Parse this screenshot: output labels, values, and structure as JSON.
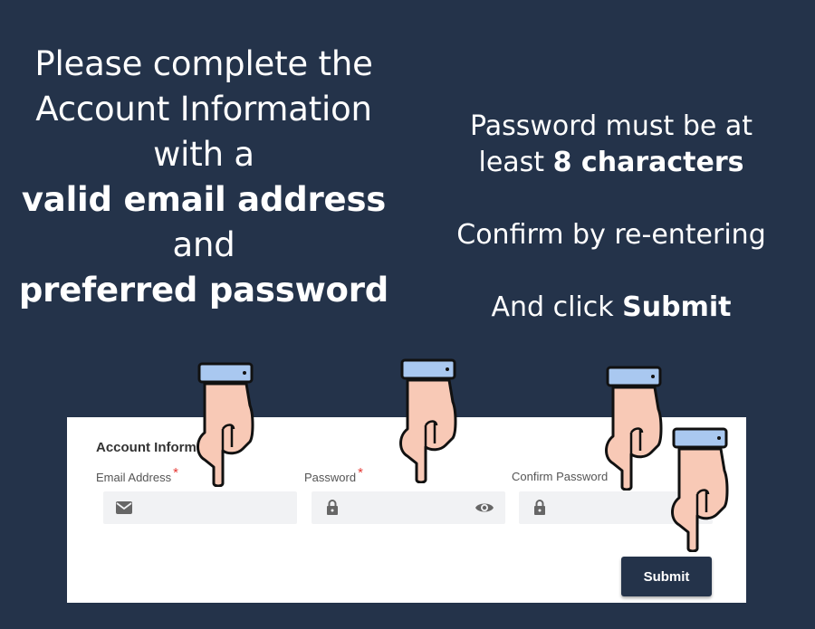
{
  "instructions_left": {
    "line1": "Please complete the",
    "line2": "Account Information",
    "line3": "with a",
    "line4": "valid email address",
    "line5": "and",
    "line6": "preferred password"
  },
  "instructions_right": {
    "line1": "Password must be at",
    "line2_prefix": "least ",
    "line2_bold": "8 characters",
    "line3": "Confirm by re-entering",
    "line4_prefix": "And click ",
    "line4_bold": "Submit"
  },
  "form": {
    "title": "Account Information",
    "required_marker": "*",
    "email": {
      "label": "Email Address",
      "value": "",
      "icon": "envelope-icon"
    },
    "password": {
      "label": "Password",
      "value": "",
      "icon": "lock-icon",
      "toggle_icon": "eye-icon"
    },
    "confirm": {
      "label": "Confirm Password",
      "value": "",
      "icon": "lock-icon"
    },
    "submit_label": "Submit"
  },
  "colors": {
    "background": "#24334a",
    "panel": "#ffffff",
    "required": "#e53935",
    "field_bg": "#f1f2f4",
    "button": "#24334a"
  }
}
